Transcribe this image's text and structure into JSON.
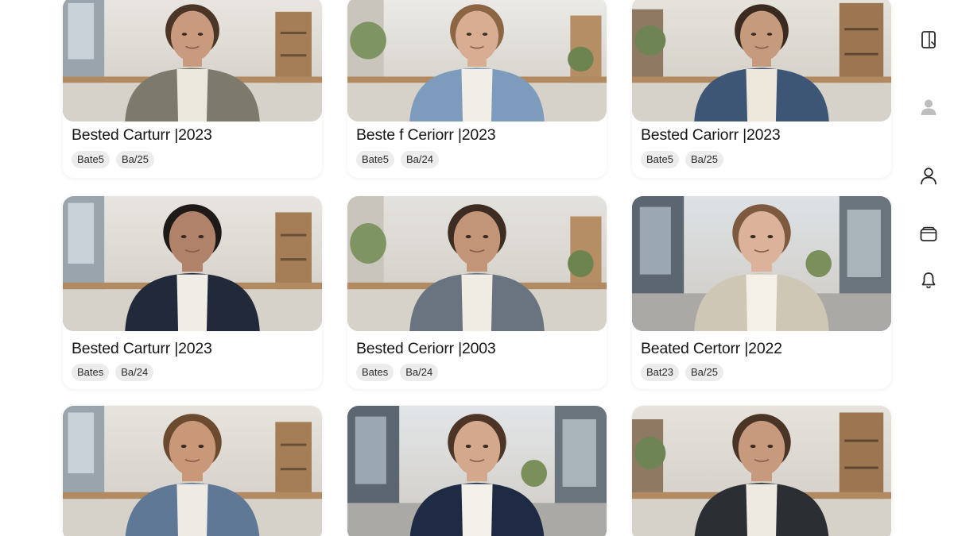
{
  "cards": [
    {
      "title": "Bested Carturr |2023",
      "tags": [
        "Bate5",
        "Ba/25"
      ],
      "photo": {
        "wall": "#e9e6e1",
        "shirt": "#7b7a6c",
        "under": "#ece7dd",
        "hair": "#4a3527",
        "skin": "#c99a7e",
        "scene": "office-left"
      }
    },
    {
      "title": "Beste f Ceriorr |2023",
      "tags": [
        "Bate5",
        "Ba/24"
      ],
      "photo": {
        "wall": "#ecebe8",
        "shirt": "#7d9bbd",
        "under": "#f1eee8",
        "hair": "#8c6644",
        "skin": "#d8ad92",
        "scene": "office-plant"
      }
    },
    {
      "title": "Bested Cariorr |2023",
      "tags": [
        "Bate5",
        "Ba/25"
      ],
      "photo": {
        "wall": "#e6e3dc",
        "shirt": "#3d5675",
        "under": "#ede7dc",
        "hair": "#3a2a1f",
        "skin": "#c69a7d",
        "scene": "office-right"
      }
    },
    {
      "title": "Bested Carturr |2023",
      "tags": [
        "Bates",
        "Ba/24"
      ],
      "photo": {
        "wall": "#e8e5e0",
        "shirt": "#22293a",
        "under": "#f0ece6",
        "hair": "#1d1a18",
        "skin": "#b0826a",
        "scene": "office-left"
      }
    },
    {
      "title": "Bested Ceriorr |2003",
      "tags": [
        "Bates",
        "Ba/24"
      ],
      "photo": {
        "wall": "#e4e2de",
        "shirt": "#6a7480",
        "under": "#f1ece3",
        "hair": "#3c2c22",
        "skin": "#c29578",
        "scene": "office-plant"
      }
    },
    {
      "title": "Beated Certorr |2022",
      "tags": [
        "Bat23",
        "Ba/25"
      ],
      "photo": {
        "wall": "#dde2e6",
        "shirt": "#cfc7b6",
        "under": "#f4f0e8",
        "hair": "#7d5a3f",
        "skin": "#dcb39a",
        "scene": "street"
      }
    },
    {
      "title": "",
      "tags": [],
      "photo": {
        "wall": "#e7e3dd",
        "shirt": "#5e7896",
        "under": "#efebe4",
        "hair": "#6b4a30",
        "skin": "#c99878",
        "scene": "office-left"
      }
    },
    {
      "title": "",
      "tags": [],
      "photo": {
        "wall": "#e2e5e8",
        "shirt": "#1f2b44",
        "under": "#f3f0ea",
        "hair": "#4c3426",
        "skin": "#d3a88c",
        "scene": "street"
      }
    },
    {
      "title": "",
      "tags": [],
      "photo": {
        "wall": "#e6e2dc",
        "shirt": "#2b2f33",
        "under": "#eee9e1",
        "hair": "#4a3426",
        "skin": "#c79a7e",
        "scene": "office-right"
      }
    }
  ],
  "rail": [
    {
      "icon": "tablet-icon"
    },
    {
      "icon": "user-avatar-icon"
    },
    {
      "icon": "profile-icon"
    },
    {
      "icon": "folder-icon"
    },
    {
      "icon": "bell-icon"
    }
  ]
}
